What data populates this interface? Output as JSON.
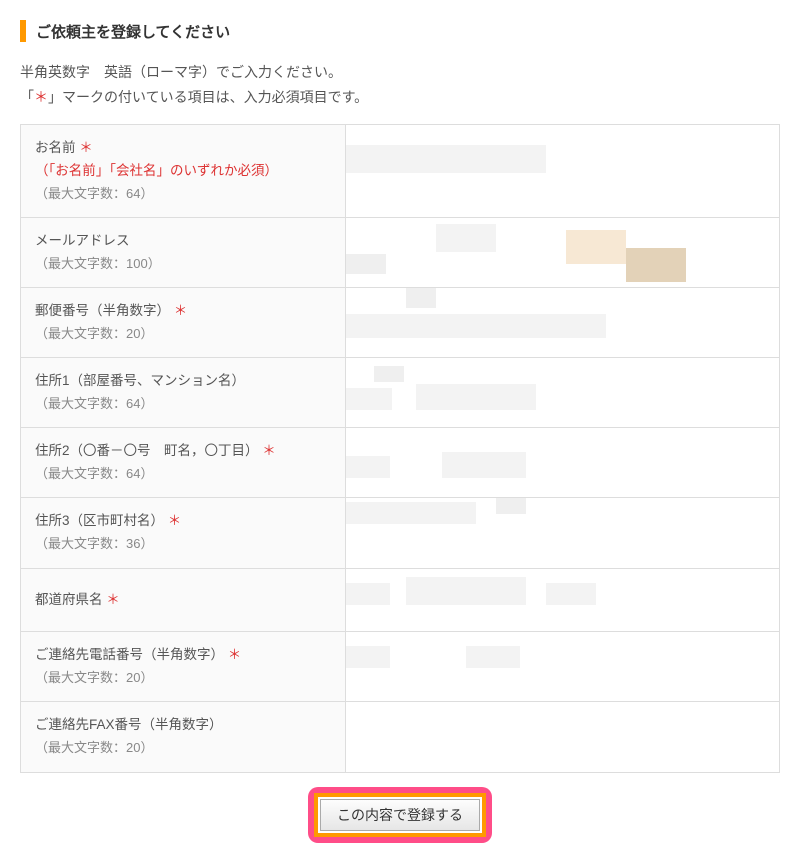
{
  "heading": "ご依頼主を登録してください",
  "instructions": {
    "line1": "半角英数字　英語（ローマ字）でご入力ください。",
    "line2_pre": "「",
    "line2_star": "＊",
    "line2_post": "」マークの付いている項目は、入力必須項目です。"
  },
  "fields": [
    {
      "label": "お名前 ",
      "required": true,
      "required_extra": "（「お名前」「会社名」のいずれか必須）",
      "note": "（最大文字数：64）"
    },
    {
      "label": "メールアドレス",
      "required": false,
      "required_extra": "",
      "note": "（最大文字数：100）"
    },
    {
      "label": "郵便番号（半角数字） ",
      "required": true,
      "required_extra": "",
      "note": "（最大文字数：20）"
    },
    {
      "label": "住所1（部屋番号、マンション名）",
      "required": false,
      "required_extra": "",
      "note": "（最大文字数：64）"
    },
    {
      "label": "住所2（〇番－〇号　町名，〇丁目） ",
      "required": true,
      "required_extra": "",
      "note": "（最大文字数：64）"
    },
    {
      "label": "住所3（区市町村名） ",
      "required": true,
      "required_extra": "",
      "note": "（最大文字数：36）"
    },
    {
      "label": "都道府県名 ",
      "required": true,
      "required_extra": "",
      "note": ""
    },
    {
      "label": "ご連絡先電話番号（半角数字） ",
      "required": true,
      "required_extra": "",
      "note": "（最大文字数：20）"
    },
    {
      "label": "ご連絡先FAX番号（半角数字）",
      "required": false,
      "required_extra": "",
      "note": "（最大文字数：20）"
    }
  ],
  "submit_label": "この内容で登録する",
  "required_mark": "＊"
}
